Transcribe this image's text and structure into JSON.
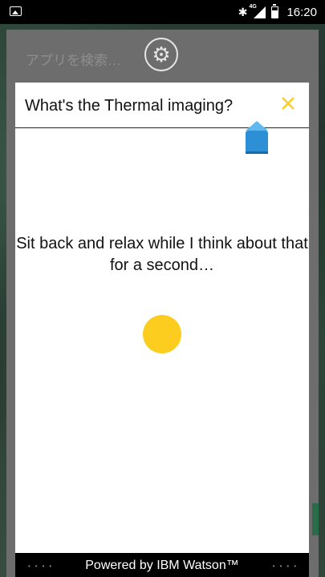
{
  "status_bar": {
    "time": "16:20",
    "network": "4G",
    "icons": [
      "image-notification-icon",
      "bluetooth-icon",
      "signal-icon",
      "battery-icon"
    ]
  },
  "app_panel": {
    "search_placeholder": "アプリを検索…",
    "settings_icon": "gear-icon"
  },
  "watson": {
    "query": "What's the Thermal imaging?",
    "thinking_message": "Sit back and relax while I think about that for a second…",
    "footer": "Powered by IBM Watson™",
    "accent_color": "#fccc1f",
    "pin_color": "#2d8fd6"
  }
}
